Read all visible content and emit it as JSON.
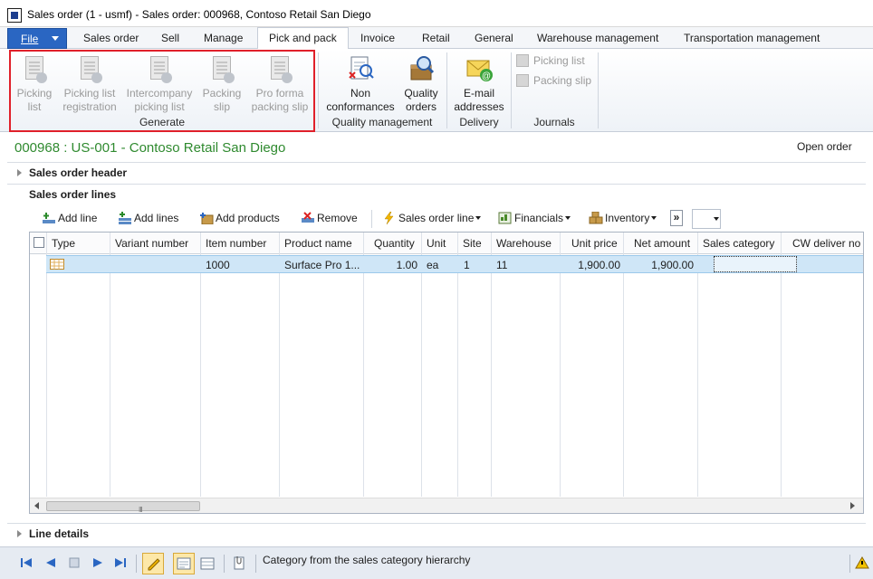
{
  "window": {
    "title": "Sales order (1 - usmf) - Sales order: 000968, Contoso Retail San Diego"
  },
  "ribbon_tabs": {
    "file": "File",
    "items": [
      "Sales order",
      "Sell",
      "Manage",
      "Pick and pack",
      "Invoice",
      "Retail",
      "General",
      "Warehouse management",
      "Transportation management"
    ],
    "active": "Pick and pack"
  },
  "ribbon": {
    "generate": {
      "label": "Generate",
      "buttons": [
        {
          "line1": "Picking",
          "line2": "list"
        },
        {
          "line1": "Picking list",
          "line2": "registration"
        },
        {
          "line1": "Intercompany",
          "line2": "picking list"
        },
        {
          "line1": "Packing",
          "line2": "slip"
        },
        {
          "line1": "Pro forma",
          "line2": "packing slip"
        }
      ]
    },
    "quality": {
      "label": "Quality management",
      "buttons": [
        {
          "line1": "Non",
          "line2": "conformances"
        },
        {
          "line1": "Quality",
          "line2": "orders"
        }
      ]
    },
    "delivery": {
      "label": "Delivery",
      "buttons": [
        {
          "line1": "E-mail",
          "line2": "addresses"
        }
      ]
    },
    "journals": {
      "label": "Journals",
      "buttons": [
        "Picking list",
        "Packing slip"
      ]
    }
  },
  "form": {
    "heading": "000968 : US-001 - Contoso Retail San Diego",
    "status": "Open order",
    "header_fasttab": "Sales order header",
    "lines_fasttab": "Sales order lines",
    "details_fasttab": "Line details"
  },
  "lines_toolbar": {
    "add_line": "Add line",
    "add_lines": "Add lines",
    "add_products": "Add products",
    "remove": "Remove",
    "sales_order_line": "Sales order line",
    "financials": "Financials",
    "inventory": "Inventory",
    "more": "»"
  },
  "grid": {
    "columns": [
      "Type",
      "Variant number",
      "Item number",
      "Product name",
      "Quantity",
      "Unit",
      "Site",
      "Warehouse",
      "Unit price",
      "Net amount",
      "Sales category",
      "CW deliver no"
    ],
    "rows": [
      {
        "item_number": "1000",
        "product_name": "Surface Pro 1...",
        "quantity": "1.00",
        "unit": "ea",
        "site": "1",
        "warehouse": "11",
        "unit_price": "1,900.00",
        "net_amount": "1,900.00",
        "sales_category": "",
        "cw_deliver": ""
      }
    ],
    "scroll_grip": "III"
  },
  "statusbar": {
    "text": "Category from the sales category hierarchy"
  },
  "colors": {
    "accent": "#2a66c2",
    "heading_green": "#2f8a2f",
    "highlight_red": "#e0202a",
    "row_selected": "#cfe6f7"
  }
}
